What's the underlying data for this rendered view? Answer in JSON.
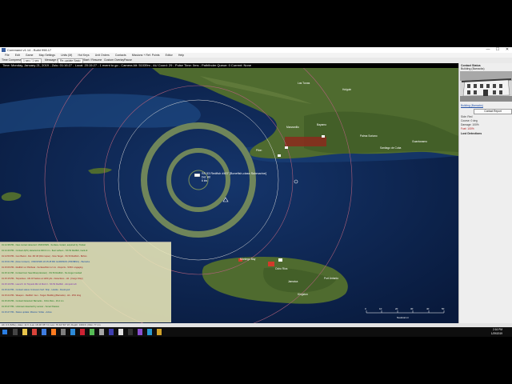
{
  "window": {
    "title": "Command v1.14 - Build 998.17",
    "minimize": "—",
    "maximize": "☐",
    "close": "✕"
  },
  "menu": [
    "File",
    "Edit",
    "Game",
    "Map Settings",
    "Units (M)",
    "Hot Keys",
    "Unit Orders",
    "Contacts",
    "Missions + Ref. Points",
    "Editor",
    "Help"
  ],
  "toolbar": {
    "time_compression_label": "Time Compression",
    "time_compression_value": "1 sec / 1 sec",
    "start_label": "Start / Resume",
    "message_log_label": "Message Log",
    "message_log_value": "Re-update Basic",
    "start_resume": "Start / Resume",
    "custom_overlay": "Custom Overlay",
    "pause": "Pause"
  },
  "status_line": "Time: Monday, January 21, 2019 - Zulu: 01:16:27 - Local: 20:15:27 - 1 event to go - Camera Alt: 51039m - AU Coord: 29 - Pulse Time: 0ms - Pathfinder Queue: 0 Current: None",
  "map": {
    "contact_label": "SS 53 Redfish #407 [Bonefish-class Submarine]",
    "contact_sub1": "Det: Alt",
    "contact_sub2": "6 kts",
    "place_labels": [
      "Las Tunas",
      "Holguin",
      "Manzanillo",
      "Bayamo",
      "Palma Soriano",
      "Santiago de Cuba",
      "Guantanamo",
      "Pilon",
      "Jamaica",
      "Montego Bay",
      "Ocho Rios",
      "Port Antonio",
      "Kingston"
    ],
    "scale_labels": [
      "0",
      "10",
      "20",
      "30",
      "40",
      "50"
    ],
    "scale_unit": "Nautical mi"
  },
  "side_panel": {
    "title": "Contact Status",
    "subtitle": "Building (Barracks)",
    "link": "Building (Barracks)",
    "contact_report_button": "Contact Report",
    "info": [
      "Side: Red",
      "Course: 0 deg",
      "Damage: 100%",
      "Fuel: 100%"
    ],
    "detections_header": "Lost Detections"
  },
  "log": [
    "01:14:38 PM - New contact detected: UNKNOWN - Surface contact, acquired by: Tanker",
    "01:14:40 PM - Contact A(PL) detected at 000.0 nm - fleet surface - SS 53 Redfish, track-id",
    "01:14:50 PM - Gun Barrel - Det. ZR 48 (00m lapse) - New Target - SS 53 Redfish - Bofors",
    "01:15:01 PM - [New Contact] - UNKNOWN 20:15:28 MN GARRISON (PROBING) - Barracks",
    "01:15:06 PM - Redfish vs: Pilotboat - Surface/Dist 4.2 nm - Reports - SS53: engaging",
    "01:15:11 PM - Contact lost: Sea Mine(unknown) - SS 53 Redfish - No longer tracked",
    "01:15:15 PM - Torpedoes - Mk 18 Salvos at 1200 yds - Detections - Hit - [Cargo Ship]",
    "01:15:19 PM - Launch: 3x Torpedo Mk 14 Mod 3 - SS 53 Redfish - Aimpoint aft",
    "01:15:22 PM - Contact status: Unknown Surf. Ship - Hostile - Destroyed",
    "01:15:24 PM - Weapon - Redfish: Gun - Target: Building (Barracks) - Hit - 25% dmg",
    "01:15:26 PM - Contact Detected: Barracks - Ocho Rios - 16.2 nm",
    "01:15:27 PM - Unknown detected by sensor - Sonar Passive",
    "01:15:27 PM - Status update: Mission: Strike - Active"
  ],
  "statusbar": "Alt: 0 ft (MSL) | Elev: 11 ft | Lat: 18 49' 05\" N | Lon: 76 42' 50\" W | Depth: 3160 ft | Dist: 77 nm",
  "clock": {
    "time": "2:16 PM",
    "date": "1/29/2019"
  },
  "colors": {
    "ocean": "#0b2149",
    "land": "#4e6a2e",
    "ring": "#7a8f5a",
    "range_ring": "#b0607a",
    "log_bg": "#ebe8ba"
  }
}
